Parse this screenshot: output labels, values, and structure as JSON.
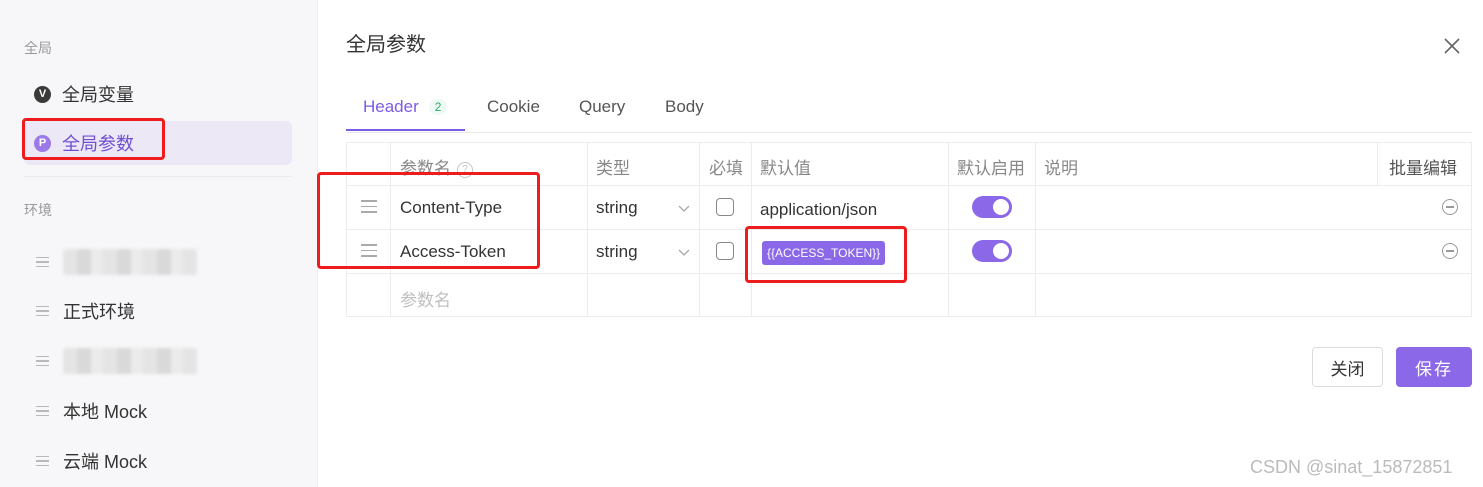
{
  "sidebar": {
    "global_section": "全局",
    "global_items": [
      {
        "label": "全局变量",
        "icon": "V",
        "icon_name": "variable-icon"
      },
      {
        "label": "全局参数",
        "icon": "P",
        "icon_name": "parameter-icon",
        "active": true
      }
    ],
    "env_section": "环境",
    "env_items": [
      {
        "label": "",
        "blurred": true
      },
      {
        "label": "正式环境"
      },
      {
        "label": "",
        "blurred": true
      },
      {
        "label": "本地 Mock"
      },
      {
        "label": "云端 Mock"
      }
    ]
  },
  "panel": {
    "title": "全局参数",
    "tabs": [
      {
        "label": "Header",
        "count": "2",
        "active": true
      },
      {
        "label": "Cookie"
      },
      {
        "label": "Query"
      },
      {
        "label": "Body"
      }
    ],
    "table": {
      "headers": {
        "name": "参数名",
        "type": "类型",
        "required": "必填",
        "default": "默认值",
        "enabled": "默认启用",
        "desc": "说明",
        "bulk_edit": "批量编辑"
      },
      "rows": [
        {
          "name": "Content-Type",
          "type": "string",
          "required": false,
          "default": "application/json",
          "enabled": true,
          "desc": ""
        },
        {
          "name": "Access-Token",
          "type": "string",
          "required": false,
          "default": "{{ACCESS_TOKEN}}",
          "default_is_variable": true,
          "enabled": true,
          "desc": ""
        }
      ],
      "new_row_placeholder": "参数名"
    },
    "buttons": {
      "close": "关闭",
      "save": "保存"
    }
  },
  "watermark": "CSDN @sinat_15872851",
  "colors": {
    "accent": "#8a68e8",
    "annotation_red": "#ee1c1c",
    "active_bg": "#ece8f6"
  }
}
